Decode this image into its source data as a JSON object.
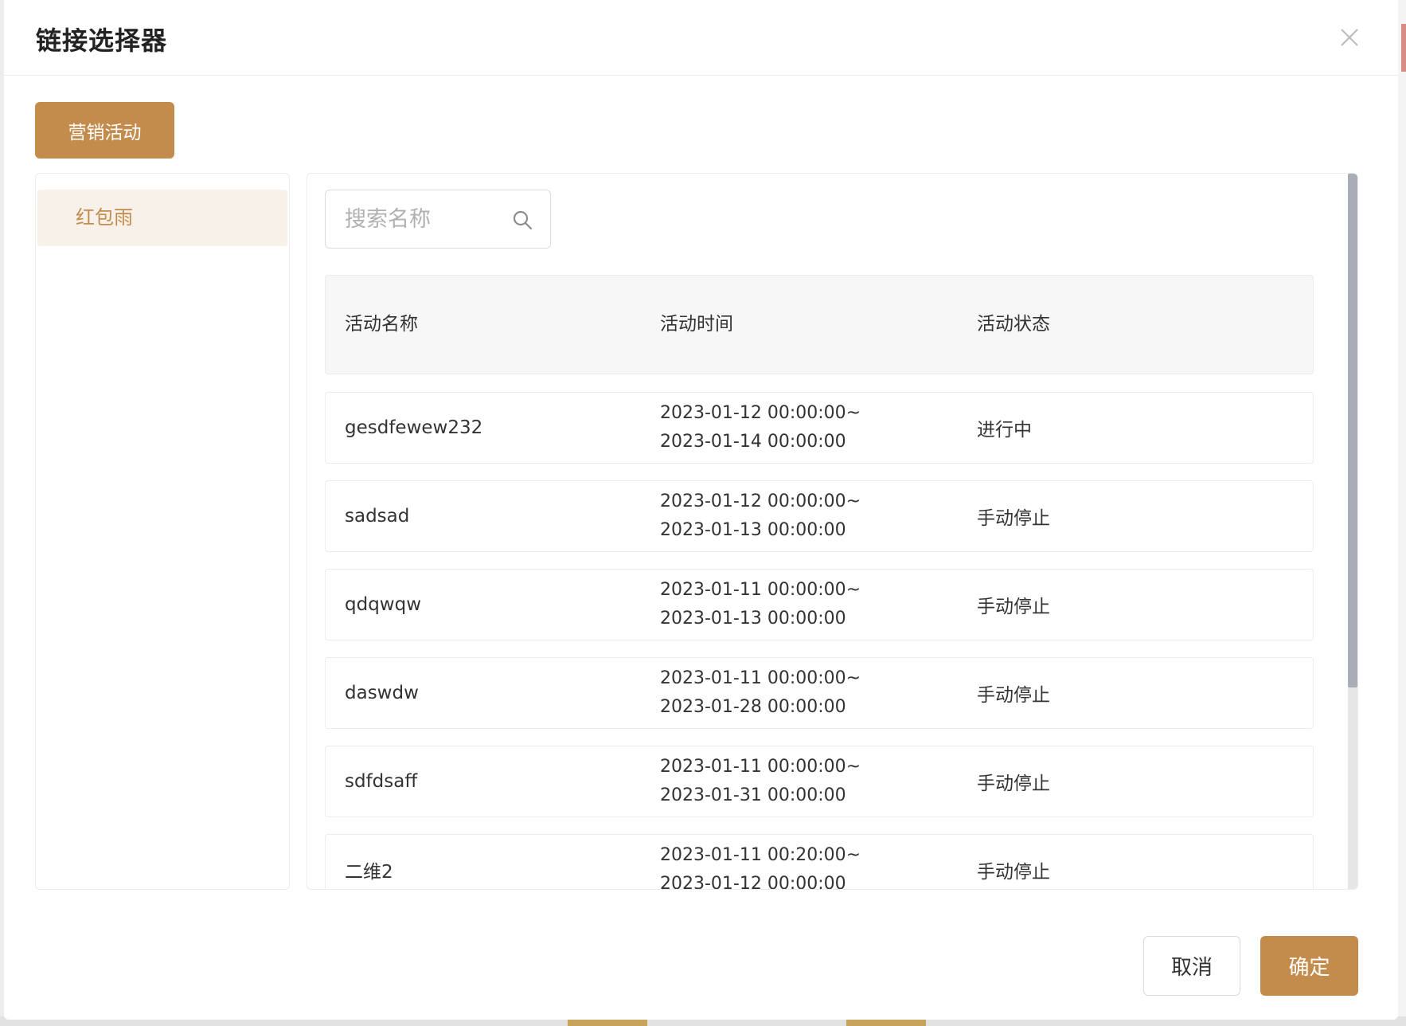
{
  "dialog": {
    "title": "链接选择器"
  },
  "tabs": [
    {
      "label": "营销活动",
      "active": true
    }
  ],
  "sidebar": {
    "items": [
      {
        "label": "红包雨",
        "active": true
      }
    ]
  },
  "search": {
    "placeholder": "搜索名称",
    "value": ""
  },
  "table": {
    "columns": [
      "活动名称",
      "活动时间",
      "活动状态"
    ],
    "rows": [
      {
        "name": "gesdfewew232",
        "time_start": "2023-01-12 00:00:00~",
        "time_end": "2023-01-14 00:00:00",
        "status": "进行中"
      },
      {
        "name": "sadsad",
        "time_start": "2023-01-12 00:00:00~",
        "time_end": "2023-01-13 00:00:00",
        "status": "手动停止"
      },
      {
        "name": "qdqwqw",
        "time_start": "2023-01-11 00:00:00~",
        "time_end": "2023-01-13 00:00:00",
        "status": "手动停止"
      },
      {
        "name": "daswdw",
        "time_start": "2023-01-11 00:00:00~",
        "time_end": "2023-01-28 00:00:00",
        "status": "手动停止"
      },
      {
        "name": "sdfdsaff",
        "time_start": "2023-01-11 00:00:00~",
        "time_end": "2023-01-31 00:00:00",
        "status": "手动停止"
      },
      {
        "name": "二维2",
        "time_start": "2023-01-11 00:20:00~",
        "time_end": "2023-01-12 00:00:00",
        "status": "手动停止"
      }
    ]
  },
  "footer": {
    "cancel_label": "取消",
    "ok_label": "确定"
  },
  "colors": {
    "accent": "#c48c4c",
    "active_item_bg": "#f8f1ea",
    "scrollbar_thumb": "#a9adb7"
  }
}
